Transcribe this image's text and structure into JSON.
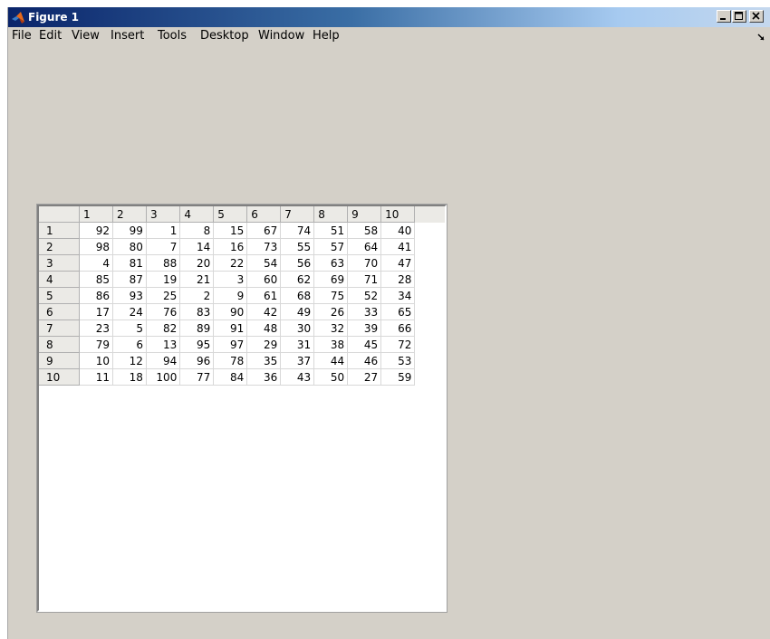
{
  "window": {
    "title": "Figure 1",
    "controls": [
      "minimize",
      "maximize",
      "close"
    ]
  },
  "menu": {
    "items": [
      "File",
      "Edit",
      "View",
      "Insert",
      "Tools",
      "Desktop",
      "Window",
      "Help"
    ]
  },
  "table": {
    "column_headers": [
      "1",
      "2",
      "3",
      "4",
      "5",
      "6",
      "7",
      "8",
      "9",
      "10"
    ],
    "row_headers": [
      "1",
      "2",
      "3",
      "4",
      "5",
      "6",
      "7",
      "8",
      "9",
      "10"
    ],
    "rows": [
      [
        92,
        99,
        1,
        8,
        15,
        67,
        74,
        51,
        58,
        40
      ],
      [
        98,
        80,
        7,
        14,
        16,
        73,
        55,
        57,
        64,
        41
      ],
      [
        4,
        81,
        88,
        20,
        22,
        54,
        56,
        63,
        70,
        47
      ],
      [
        85,
        87,
        19,
        21,
        3,
        60,
        62,
        69,
        71,
        28
      ],
      [
        86,
        93,
        25,
        2,
        9,
        61,
        68,
        75,
        52,
        34
      ],
      [
        17,
        24,
        76,
        83,
        90,
        42,
        49,
        26,
        33,
        65
      ],
      [
        23,
        5,
        82,
        89,
        91,
        48,
        30,
        32,
        39,
        66
      ],
      [
        79,
        6,
        13,
        95,
        97,
        29,
        31,
        38,
        45,
        72
      ],
      [
        10,
        12,
        94,
        96,
        78,
        35,
        37,
        44,
        46,
        53
      ],
      [
        11,
        18,
        100,
        77,
        84,
        36,
        43,
        50,
        27,
        59
      ]
    ]
  }
}
